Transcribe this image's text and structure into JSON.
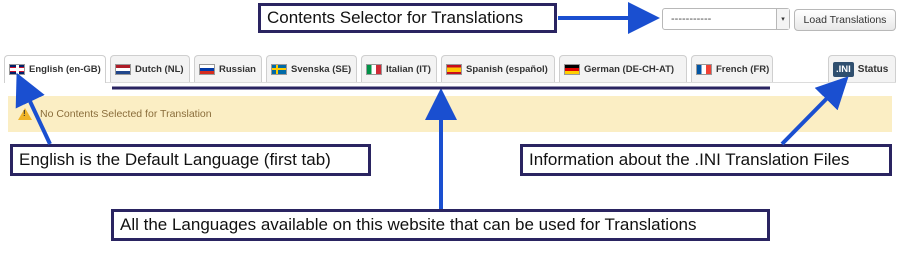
{
  "selector": {
    "value": "-----------",
    "caret": "▾"
  },
  "load_button": "Load Translations",
  "tabs": [
    {
      "label": "English (en-GB)",
      "flag": "uk-flag-icon"
    },
    {
      "label": "Dutch (NL)",
      "flag": "netherlands-flag-icon"
    },
    {
      "label": "Russian",
      "flag": "russia-flag-icon"
    },
    {
      "label": "Svenska (SE)",
      "flag": "sweden-flag-icon"
    },
    {
      "label": "Italian (IT)",
      "flag": "italy-flag-icon"
    },
    {
      "label": "Spanish (español)",
      "flag": "spain-flag-icon"
    },
    {
      "label": "German (DE-CH-AT)",
      "flag": "germany-flag-icon"
    },
    {
      "label": "French (FR)",
      "flag": "france-flag-icon"
    }
  ],
  "status_tab": {
    "badge": ".INI",
    "label": "Status"
  },
  "alert": {
    "text": "No Contents Selected for Translation",
    "icon": "warning-icon",
    "icon_glyph": "!"
  },
  "annotations": {
    "selector": "Contents Selector for Translations",
    "default_language": "English is the Default Language (first tab)",
    "ini_info": "Information about the .INI Translation Files",
    "languages": "All the Languages available on this website that can be used for Translations"
  },
  "colors": {
    "annotation_arrow": "#1a4fd0",
    "annotation_border": "#2a2461",
    "alert_bg": "#fbeec4"
  }
}
